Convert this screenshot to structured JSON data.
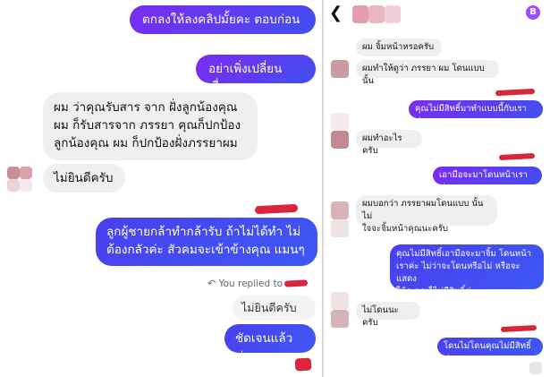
{
  "left": {
    "messages": [
      {
        "text": "ตกลงให้ลงคลิปมั้ยคะ ตอบก่อน"
      },
      {
        "text": "อย่าเพิ่งเปลี่ยนเรื่อง"
      },
      {
        "lines": [
          "ผม ว่าคุณรับสาร จาก ฝั่งลูกน้องคุณ",
          "ผม ก็รับสารจาก ภรรยา คุณก็ปกป้อง",
          "ลูกน้องคุณ ผม ก็ปกป้องฝั่งภรรยาผม"
        ]
      },
      {
        "text": "ไม่ยินดีครับ"
      },
      {
        "lines": [
          "ลูกผู้ชายกล้าทำกล้ารับ ถ้าไม่ได้ทำ ไม่",
          "ต้องกลัวค่ะ สัวคมจะเข้าข้างคุณ แมนๆ"
        ]
      },
      {
        "text": "ไม่ยินดีครับ"
      },
      {
        "text": "ชัดเจนแล้วค่ะ"
      }
    ],
    "reply_note": "You replied to"
  },
  "right": {
    "header": {
      "back_icon": "chevron-left-icon",
      "avatar_color": "#e0a0b0",
      "badge_icon": "bitcoin-icon",
      "badge_color": "#9b4dff"
    },
    "messages": [
      {
        "text": "ผม จิ้มหน้าหรอครับ"
      },
      {
        "text": "ผมทำให้ดูว่า ภรรยา ผม โดนแบบนั้น"
      },
      {
        "text": "คุณไม่มีสิทธิ์มาทำแบบนี้กับเราค่ะ"
      },
      {
        "text": "ผมทำอะไรครับ"
      },
      {
        "text": "เอามือจะมาโดนหน้าเราค่ะ"
      },
      {
        "lines": [
          "ผมบอกว่า ภรรยาผมโดนแบบ นั้น ไม่",
          "ใจจะจิ้มหน้าคุณนะครับ"
        ]
      },
      {
        "lines": [
          "คุณไม่มีสิทธิ์เอามือจะมาจิ้ม โดนหน้า",
          "เราค่ะ ไม่ว่าจะโดนหรือไม่ หรือจะแสดง",
          "ให้ดู คุณก็ไม่มีสิทธิ์ค่ะ"
        ]
      },
      {
        "text": "ไม่โดนนะครับ"
      },
      {
        "text": "โดนไม่โดนคุณไม่มีสิทธิ์ค่ะ"
      }
    ]
  },
  "colors": {
    "accent": "#5a3ff0",
    "incoming": "#efeff2",
    "redaction": "#d8263a"
  }
}
